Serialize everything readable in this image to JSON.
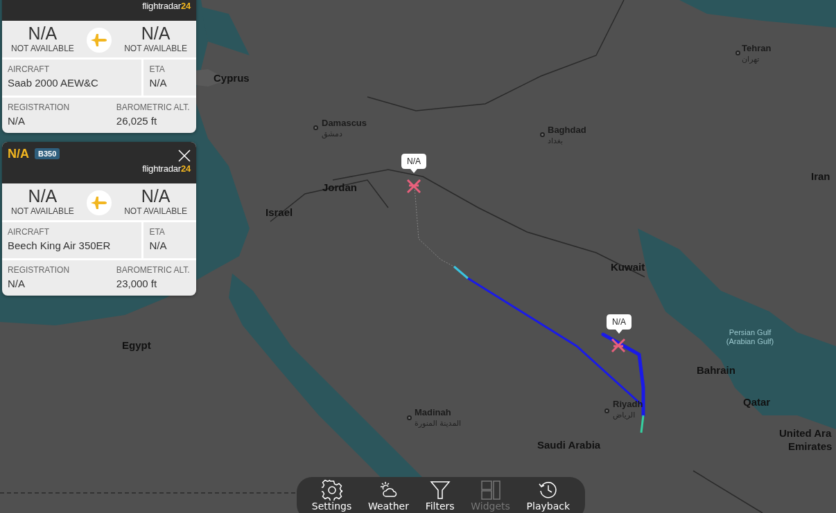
{
  "flights": [
    {
      "logo": {
        "main": "flightradar",
        "accent": "24"
      },
      "origin": {
        "code": "N/A",
        "name": "NOT AVAILABLE"
      },
      "destination": {
        "code": "N/A",
        "name": "NOT AVAILABLE"
      },
      "fields": [
        {
          "label": "AIRCRAFT",
          "value": "Saab 2000 AEW&C"
        },
        {
          "label": "ETA",
          "value": "N/A"
        },
        {
          "label": "REGISTRATION",
          "value": "N/A"
        },
        {
          "label": "BAROMETRIC ALT.",
          "value": "26,025 ft"
        }
      ]
    },
    {
      "callsign": "N/A",
      "type_badge": "B350",
      "closable": true,
      "logo": {
        "main": "flightradar",
        "accent": "24"
      },
      "origin": {
        "code": "N/A",
        "name": "NOT AVAILABLE"
      },
      "destination": {
        "code": "N/A",
        "name": "NOT AVAILABLE"
      },
      "fields": [
        {
          "label": "AIRCRAFT",
          "value": "Beech King Air 350ER"
        },
        {
          "label": "ETA",
          "value": "N/A"
        },
        {
          "label": "REGISTRATION",
          "value": "N/A"
        },
        {
          "label": "BAROMETRIC ALT.",
          "value": "23,000 ft"
        }
      ]
    }
  ],
  "map_labels": [
    {
      "kind": "country",
      "name": "Cyprus"
    },
    {
      "kind": "city",
      "name": "Damascus",
      "local": "دمشق"
    },
    {
      "kind": "city",
      "name": "Baghdad",
      "local": "بغداد"
    },
    {
      "kind": "city",
      "name": "Tehran",
      "local": "تهران"
    },
    {
      "kind": "country",
      "name": "Jordan"
    },
    {
      "kind": "country",
      "name": "Israel"
    },
    {
      "kind": "country",
      "name": "Iran"
    },
    {
      "kind": "country",
      "name": "Kuwait"
    },
    {
      "kind": "water",
      "name": "Persian Gulf (Arabian Gulf)"
    },
    {
      "kind": "country",
      "name": "Bahrain"
    },
    {
      "kind": "country",
      "name": "Qatar"
    },
    {
      "kind": "country",
      "name": "United Ara"
    },
    {
      "kind": "country",
      "name": "Emirates"
    },
    {
      "kind": "country",
      "name": "Egypt"
    },
    {
      "kind": "city",
      "name": "Riyadh",
      "local": "الرياض"
    },
    {
      "kind": "city",
      "name": "Madinah",
      "local": "المدينة المنورة"
    },
    {
      "kind": "country",
      "name": "Saudi Arabia"
    }
  ],
  "aircraft_markers": [
    {
      "label": "N/A"
    },
    {
      "label": "N/A"
    }
  ],
  "toolbar": [
    {
      "kind": "settings",
      "label": "Settings",
      "disabled": false
    },
    {
      "kind": "weather",
      "label": "Weather",
      "disabled": false
    },
    {
      "kind": "filters",
      "label": "Filters",
      "disabled": false
    },
    {
      "kind": "widgets",
      "label": "Widgets",
      "disabled": true
    },
    {
      "kind": "playback",
      "label": "Playback",
      "disabled": false
    }
  ]
}
